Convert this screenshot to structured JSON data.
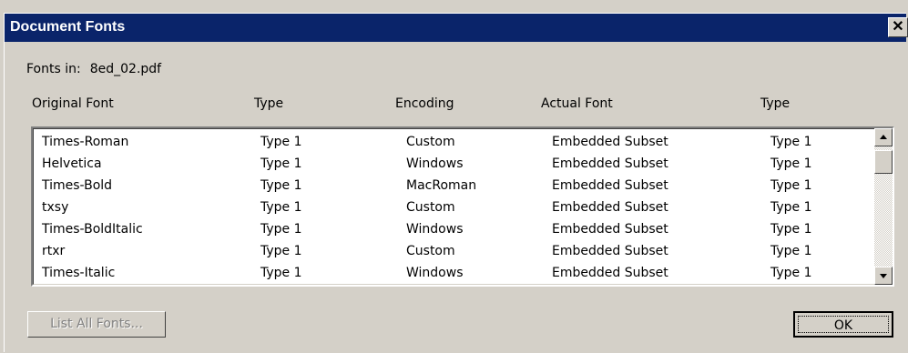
{
  "window": {
    "title": "Document Fonts",
    "close_glyph": "✕"
  },
  "fonts_in": {
    "label": "Fonts in:",
    "file": "8ed_02.pdf"
  },
  "columns": [
    "Original Font",
    "Type",
    "Encoding",
    "Actual Font",
    "Type"
  ],
  "rows": [
    [
      "Times-Roman",
      "Type 1",
      "Custom",
      "Embedded Subset",
      "Type 1"
    ],
    [
      "Helvetica",
      "Type 1",
      "Windows",
      "Embedded Subset",
      "Type 1"
    ],
    [
      "Times-Bold",
      "Type 1",
      "MacRoman",
      "Embedded Subset",
      "Type 1"
    ],
    [
      "txsy",
      "Type 1",
      "Custom",
      "Embedded Subset",
      "Type 1"
    ],
    [
      "Times-BoldItalic",
      "Type 1",
      "Windows",
      "Embedded Subset",
      "Type 1"
    ],
    [
      "rtxr",
      "Type 1",
      "Custom",
      "Embedded Subset",
      "Type 1"
    ],
    [
      "Times-Italic",
      "Type 1",
      "Windows",
      "Embedded Subset",
      "Type 1"
    ]
  ],
  "buttons": {
    "list_all": "List All Fonts...",
    "ok": "OK"
  },
  "icons": {
    "close": "close-icon",
    "scroll_up": "scroll-up-arrow-icon",
    "scroll_down": "scroll-down-arrow-icon"
  }
}
